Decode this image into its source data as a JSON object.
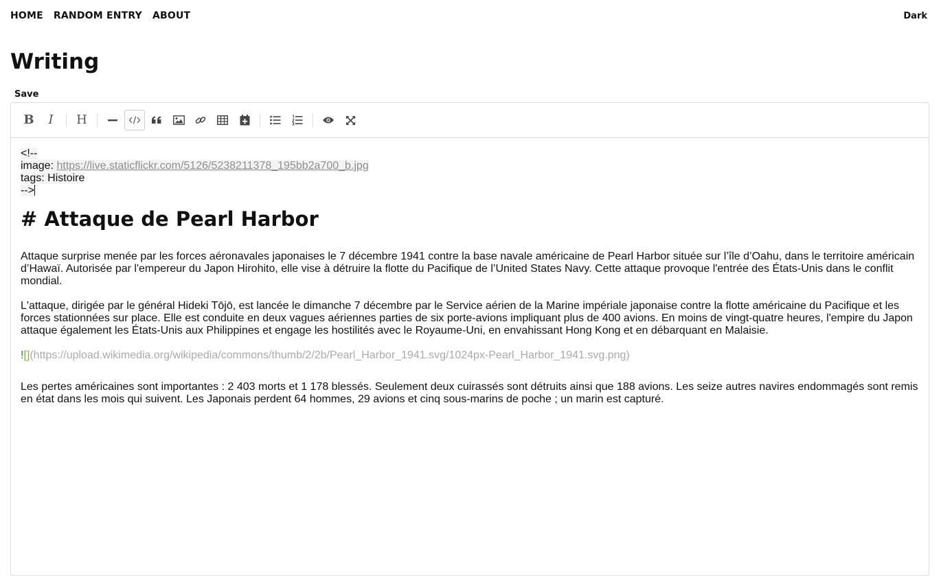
{
  "nav": {
    "items": [
      {
        "label": "HOME"
      },
      {
        "label": "RANDOM ENTRY"
      },
      {
        "label": "ABOUT"
      }
    ],
    "theme_toggle": "Dark"
  },
  "page": {
    "title": "Writing",
    "save_label": "Save"
  },
  "toolbar": {
    "buttons": [
      {
        "icon": "bold-icon",
        "text": "B"
      },
      {
        "icon": "italic-icon",
        "text": "I"
      },
      {
        "icon": "heading-icon",
        "text": "H"
      },
      {
        "icon": "horizontal-rule-icon"
      },
      {
        "icon": "code-icon",
        "active": true
      },
      {
        "icon": "quote-icon"
      },
      {
        "icon": "image-icon"
      },
      {
        "icon": "link-icon"
      },
      {
        "icon": "table-icon"
      },
      {
        "icon": "calendar-add-icon"
      },
      {
        "icon": "unordered-list-icon"
      },
      {
        "icon": "ordered-list-icon"
      },
      {
        "icon": "preview-eye-icon"
      },
      {
        "icon": "fullscreen-icon"
      }
    ]
  },
  "editor": {
    "comment_open": "<!--",
    "image_key": "image: ",
    "image_url": "https://live.staticflickr.com/5126/5238211378_195bb2a700_b.jpg",
    "tags_line": "tags: Histoire",
    "comment_close": "-->",
    "heading": "# Attaque de Pearl Harbor",
    "paragraph_1": "Attaque surprise menée par les forces aéronavales japonaises le 7 décembre 1941 contre la base navale américaine de Pearl Harbor située sur l’île d’Oahu, dans le territoire américain d’Hawaï. Autorisée par l'empereur du Japon Hirohito, elle vise à détruire la flotte du Pacifique de l’United States Navy. Cette attaque provoque l'entrée des États-Unis dans le conflit mondial.",
    "paragraph_2": "L'attaque, dirigée par le général Hideki Tōjō, est lancée le dimanche 7 décembre par le Service aérien de la Marine impériale japonaise contre la flotte américaine du Pacifique et les forces stationnées sur place. Elle est conduite en deux vagues aériennes parties de six porte-avions impliquant plus de 400 avions. En moins de vingt-quatre heures, l'empire du Japon attaque également les États-Unis aux Philippines et engage les hostilités avec le Royaume-Uni, en envahissant Hong Kong et en débarquant en Malaisie.",
    "image_md_bang": "!",
    "image_md_brackets": "[]",
    "image_md_url": "(https://upload.wikimedia.org/wikipedia/commons/thumb/2/2b/Pearl_Harbor_1941.svg/1024px-Pearl_Harbor_1941.svg.png)",
    "paragraph_3": "Les pertes américaines sont importantes : 2 403 morts et 1 178 blessés. Seulement deux cuirassés sont détruits ainsi que 188 avions. Les seize autres navires endommagés sont remis en état dans les mois qui suivent. Les Japonais perdent 64 hommes, 29 avions et cinq sous-marins de poche ; un marin est capturé."
  }
}
